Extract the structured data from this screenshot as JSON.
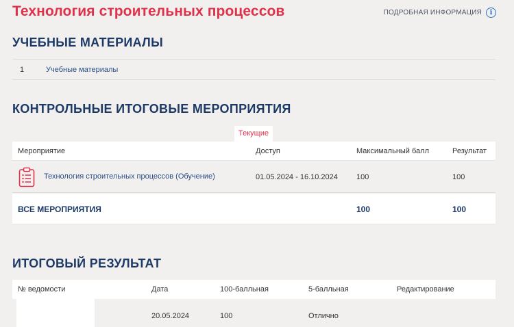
{
  "header": {
    "title": "Технология строительных процессов",
    "more_info": "ПОДРОБНАЯ ИНФОРМАЦИЯ",
    "info_icon": "i"
  },
  "materials": {
    "title": "УЧЕБНЫЕ МАТЕРИАЛЫ",
    "items": [
      {
        "num": "1",
        "label": "Учебные материалы"
      }
    ]
  },
  "events": {
    "title": "КОНТРОЛЬНЫЕ ИТОГОВЫЕ МЕРОПРИЯТИЯ",
    "tab_current": "Текущие",
    "columns": {
      "event": "Мероприятие",
      "access": "Доступ",
      "max_score": "Максимальный балл",
      "result": "Результат"
    },
    "rows": [
      {
        "icon": "clipboard-list-icon",
        "name": "Технология строительных процессов (Обучение)",
        "access": "01.05.2024 - 16.10.2024",
        "max_score": "100",
        "result": "100"
      }
    ],
    "all": {
      "label": "ВСЕ МЕРОПРИЯТИЯ",
      "max_score": "100",
      "result": "100"
    }
  },
  "results": {
    "title": "ИТОГОВЫЙ РЕЗУЛЬТАТ",
    "columns": {
      "statement": "№ ведомости",
      "date": "Дата",
      "score100": "100-балльная",
      "score5": "5-балльная",
      "editing": "Редактирование"
    },
    "rows": [
      {
        "statement": "",
        "date": "20.05.2024",
        "score100": "100",
        "score5": "Отлично",
        "editing": ""
      }
    ]
  },
  "colors": {
    "accent_red": "#e0314b",
    "heading_navy": "#1d3966",
    "link_blue": "#2a4d85",
    "background": "#f1f0ef"
  }
}
